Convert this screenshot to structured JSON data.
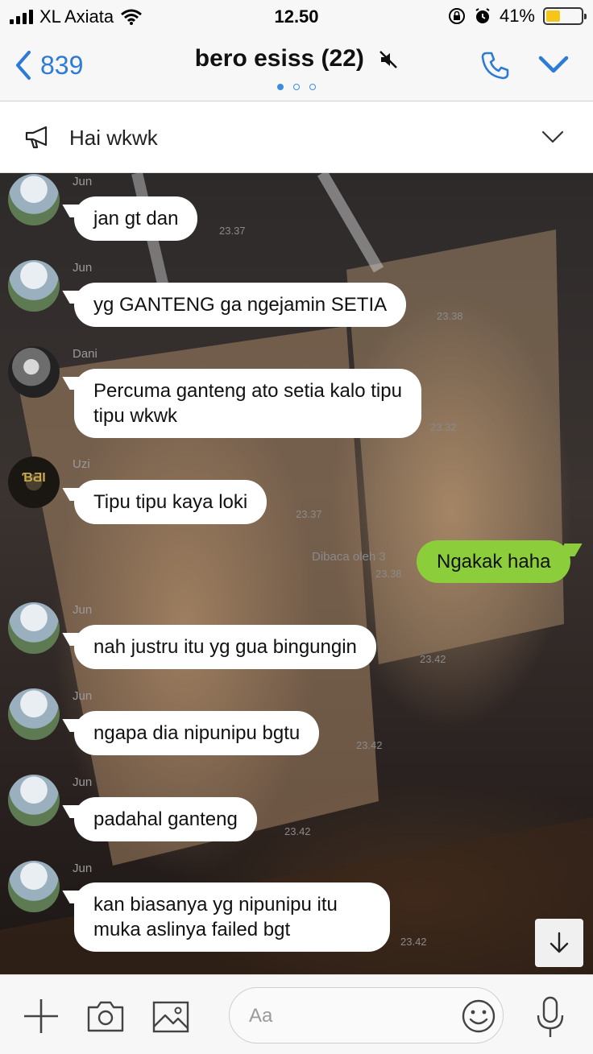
{
  "status_bar": {
    "carrier": "XL Axiata",
    "time": "12.50",
    "battery_percent": "41%",
    "battery_level": 0.41
  },
  "header": {
    "back_count": "839",
    "title": "bero esiss (22)",
    "page_count": 3,
    "active_page": 1
  },
  "announcement": {
    "text": "Hai wkwk"
  },
  "messages": [
    {
      "sender": "Jun",
      "text": "jan gt dan",
      "time": "23.37"
    },
    {
      "sender": "Jun",
      "text": "yg GANTENG ga ngejamin SETIA",
      "time": "23.38"
    },
    {
      "sender": "Dani",
      "text": "Percuma ganteng ato setia kalo tipu tipu wkwk",
      "time": "23.32"
    },
    {
      "sender": "Uzi",
      "text": "Tipu tipu kaya loki",
      "time": "23.37"
    },
    {
      "sender": "me",
      "text": "Ngakak haha",
      "read": "Dibaca oleh 3",
      "time": "23.38"
    },
    {
      "sender": "Jun",
      "text": "nah justru itu yg gua bingungin",
      "time": "23.42"
    },
    {
      "sender": "Jun",
      "text": "ngapa dia nipunipu bgtu",
      "time": "23.42"
    },
    {
      "sender": "Jun",
      "text": "padahal ganteng",
      "time": "23.42"
    },
    {
      "sender": "Jun",
      "text": "kan biasanya yg nipunipu itu muka aslinya failed bgt",
      "time": "23.42"
    }
  ],
  "input": {
    "placeholder": "Aa"
  },
  "icons": {
    "back": "chevron-left-icon",
    "mute": "mute-icon",
    "call": "phone-icon",
    "menu": "chevron-down-icon",
    "announcement": "megaphone-icon",
    "scroll": "arrow-down-icon",
    "add": "plus-icon",
    "camera": "camera-icon",
    "gallery": "image-icon",
    "emoji": "emoji-icon",
    "voice": "microphone-icon"
  },
  "colors": {
    "accent": "#2c7bd6",
    "my_bubble": "#8ccd3c",
    "their_bubble": "#ffffff"
  }
}
